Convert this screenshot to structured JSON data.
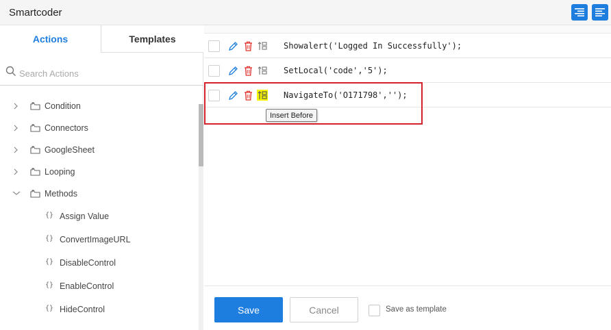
{
  "app": {
    "title": "Smartcoder"
  },
  "toolbar": {
    "buttons": [
      {
        "icon": "align-right-icon"
      },
      {
        "icon": "align-left-icon"
      }
    ],
    "accent": "#1e7ee0"
  },
  "tabs": [
    {
      "label": "Actions",
      "active": true
    },
    {
      "label": "Templates",
      "active": false
    }
  ],
  "search": {
    "placeholder": "Search Actions",
    "value": ""
  },
  "tree": {
    "folders": [
      {
        "label": "Condition",
        "expanded": false
      },
      {
        "label": "Connectors",
        "expanded": false
      },
      {
        "label": "GoogleSheet",
        "expanded": false
      },
      {
        "label": "Looping",
        "expanded": false
      },
      {
        "label": "Methods",
        "expanded": true
      }
    ],
    "methods": [
      {
        "brace": "{}",
        "label": "Assign Value"
      },
      {
        "brace": "{}",
        "label": "ConvertImageURL"
      },
      {
        "brace": "{}",
        "label": "DisableControl"
      },
      {
        "brace": "{}",
        "label": "EnableControl"
      },
      {
        "brace": "{}",
        "label": "HideControl"
      }
    ]
  },
  "code_rows": [
    {
      "code": "Showalert('Logged In Successfully');"
    },
    {
      "code": "SetLocal('code','5');"
    },
    {
      "code": "NavigateTo('O171798','');"
    }
  ],
  "tooltip": {
    "text": "Insert Before"
  },
  "footer": {
    "save_label": "Save",
    "cancel_label": "Cancel",
    "save_template_label": "Save as template"
  },
  "colors": {
    "accent": "#1e7ee0",
    "delete": "#e0302a",
    "highlight": "#f5f500",
    "annotation": "#d4202a"
  }
}
